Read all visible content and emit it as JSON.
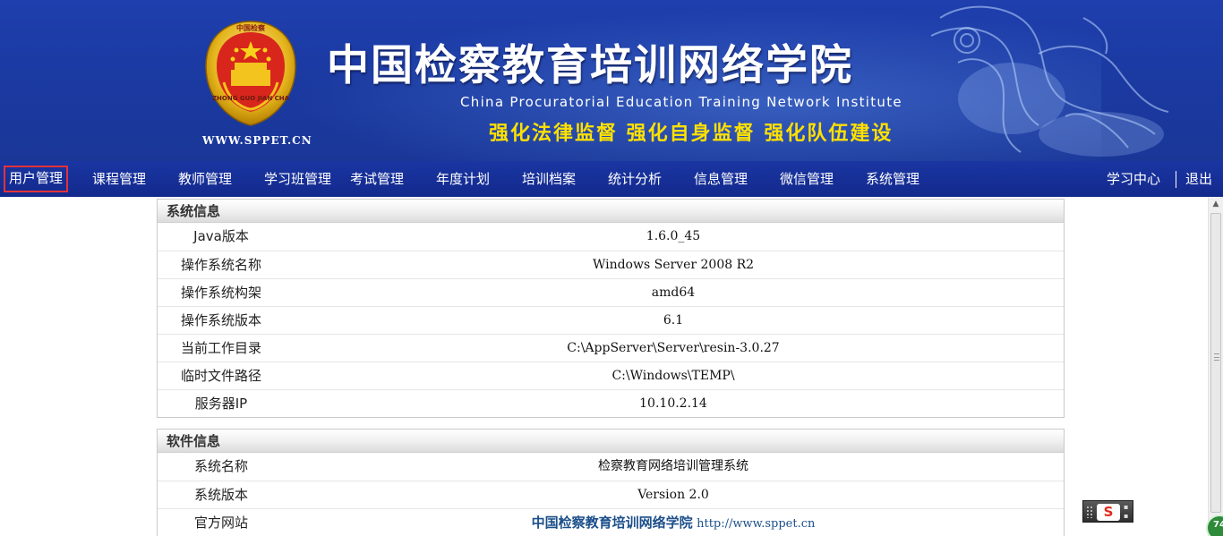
{
  "header": {
    "title": "中国检察教育培训网络学院",
    "subtitle": "China Procuratorial Education Training Network Institute",
    "slogan": "强化法律监督 强化自身监督 强化队伍建设",
    "domain": "WWW.SPPET.CN",
    "emblem_top_text": "中国检察",
    "emblem_ring_text": "ZHONG GUO JIAN CHA"
  },
  "nav": {
    "items": [
      {
        "label": "用户管理",
        "active": true
      },
      {
        "label": "课程管理",
        "active": false
      },
      {
        "label": "教师管理",
        "active": false
      },
      {
        "label": "学习班管理",
        "active": false
      },
      {
        "label": "考试管理",
        "active": false
      },
      {
        "label": "年度计划",
        "active": false
      },
      {
        "label": "培训档案",
        "active": false
      },
      {
        "label": "统计分析",
        "active": false
      },
      {
        "label": "信息管理",
        "active": false
      },
      {
        "label": "微信管理",
        "active": false
      },
      {
        "label": "系统管理",
        "active": false
      }
    ],
    "right": {
      "study_center": "学习中心",
      "logout": "退出"
    }
  },
  "system_info": {
    "heading": "系统信息",
    "rows": [
      {
        "label": "Java版本",
        "value": "1.6.0_45"
      },
      {
        "label": "操作系统名称",
        "value": "Windows Server 2008 R2"
      },
      {
        "label": "操作系统构架",
        "value": "amd64"
      },
      {
        "label": "操作系统版本",
        "value": "6.1"
      },
      {
        "label": "当前工作目录",
        "value": "C:\\AppServer\\Server\\resin-3.0.27"
      },
      {
        "label": "临时文件路径",
        "value": "C:\\Windows\\TEMP\\"
      },
      {
        "label": "服务器IP",
        "value": "10.10.2.14"
      }
    ]
  },
  "software_info": {
    "heading": "软件信息",
    "rows": [
      {
        "label": "系统名称",
        "value": "检察教育网络培训管理系统"
      },
      {
        "label": "系统版本",
        "value": "Version 2.0"
      }
    ],
    "website": {
      "label": "官方网站",
      "site_name": "中国检察教育培训网络学院",
      "url": "http://www.sppet.cn"
    }
  },
  "ime": {
    "logo": "S"
  },
  "corner_badge": {
    "value": "74"
  },
  "colors": {
    "banner": "#1b3aa3",
    "navbar": "#1a36a3",
    "slogan": "#ffe100",
    "active_outline": "#e2323a",
    "link": "#1b4f8a"
  }
}
